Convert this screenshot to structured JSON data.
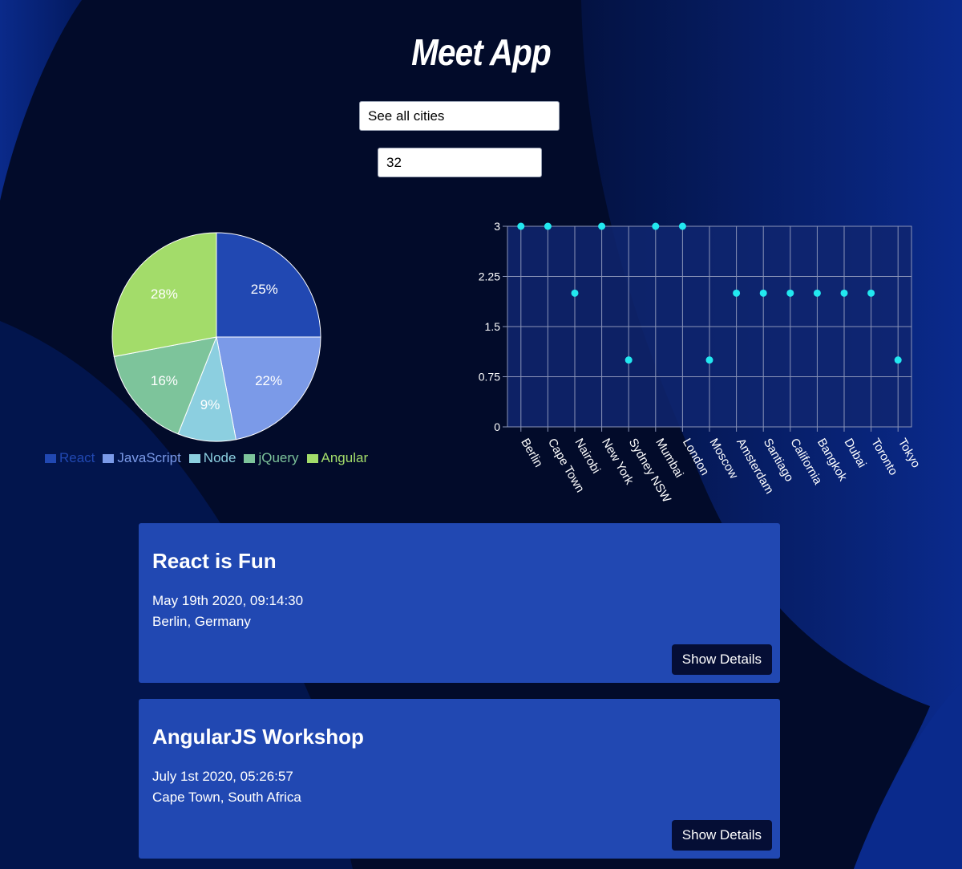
{
  "header": {
    "title": "Meet App"
  },
  "search": {
    "city_value": "See all cities",
    "event_count_value": "32"
  },
  "colors": {
    "background": "#020b2a",
    "card": "#2148b2",
    "button": "#050e35",
    "scatter_plot_area": "#0f2670",
    "scatter_point": "#22e8f0"
  },
  "pie_chart": {
    "chart_data": {
      "type": "pie",
      "legend_position": "bottom",
      "slices": [
        {
          "name": "React",
          "value": 25,
          "label": "25%",
          "color": "#2148b2"
        },
        {
          "name": "JavaScript",
          "value": 22,
          "label": "22%",
          "color": "#7b9ae8"
        },
        {
          "name": "Node",
          "value": 9,
          "label": "9%",
          "color": "#8ccfe0"
        },
        {
          "name": "jQuery",
          "value": 16,
          "label": "16%",
          "color": "#7dc49b"
        },
        {
          "name": "Angular",
          "value": 28,
          "label": "28%",
          "color": "#a3dc6a"
        }
      ]
    }
  },
  "scatter_chart": {
    "chart_data": {
      "type": "scatter",
      "categories": [
        "Berlin",
        "Cape Town",
        "Nairobi",
        "New York",
        "Sydney NSW",
        "Mumbai",
        "London",
        "Moscow",
        "Amsterdam",
        "Santiago",
        "California",
        "Bangkok",
        "Dubai",
        "Toronto",
        "Tokyo"
      ],
      "values": [
        3,
        3,
        2,
        3,
        1,
        3,
        3,
        1,
        2,
        2,
        2,
        2,
        2,
        2,
        1
      ],
      "ylim": [
        0,
        3
      ],
      "yticks": [
        "0",
        "0.75",
        "1.5",
        "2.25",
        "3"
      ],
      "grid": true
    }
  },
  "events": [
    {
      "title": "React is Fun",
      "date": "May 19th 2020, 09:14:30",
      "location": "Berlin, Germany",
      "button": "Show Details"
    },
    {
      "title": "AngularJS Workshop",
      "date": "July 1st 2020, 05:26:57",
      "location": "Cape Town, South Africa",
      "button": "Show Details"
    }
  ]
}
